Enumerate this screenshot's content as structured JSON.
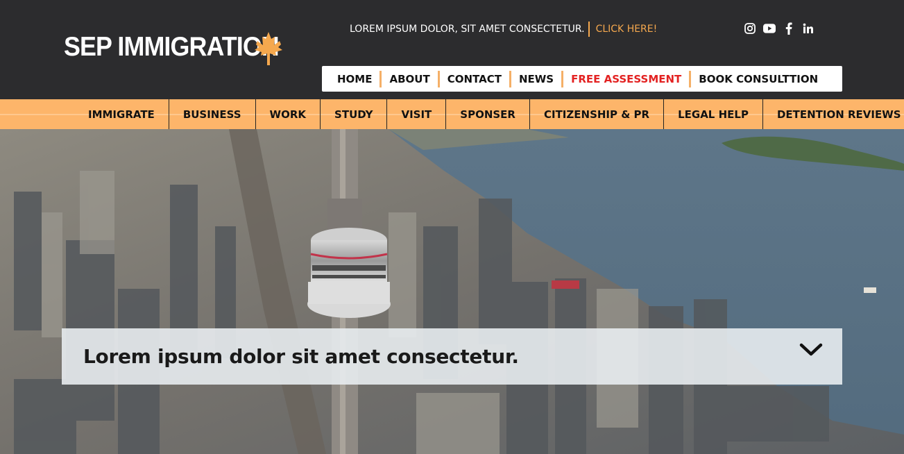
{
  "brand": {
    "name": "SEP IMMIGRATION",
    "leaf_color": "#f5a84e"
  },
  "promo": {
    "text": "LOREM IPSUM DOLOR, SIT AMET CONSECTETUR.",
    "link": "CLICK HERE!",
    "link_color": "#f5a84e"
  },
  "social": [
    "instagram-icon",
    "youtube-icon",
    "facebook-icon",
    "linkedin-icon"
  ],
  "main_nav": [
    {
      "label": "HOME"
    },
    {
      "label": "ABOUT"
    },
    {
      "label": "CONTACT"
    },
    {
      "label": "NEWS"
    },
    {
      "label": "FREE ASSESSMENT",
      "color": "#e32222"
    },
    {
      "label": "BOOK CONSULTTION"
    }
  ],
  "category_nav": [
    "IMMIGRATE",
    "BUSINESS",
    "WORK",
    "STUDY",
    "VISIT",
    "SPONSER",
    "CITIZENSHIP & PR",
    "LEGAL HELP",
    "DETENTION REVIEWS"
  ],
  "hero": {
    "accordion_title": "Lorem ipsum dolor sit amet consectetur.",
    "accordion_icon": "chevron-down-icon"
  },
  "colors": {
    "topbar_bg": "#2c2c2e",
    "category_bar": "#fdb56a",
    "accent": "#f5a84e"
  }
}
